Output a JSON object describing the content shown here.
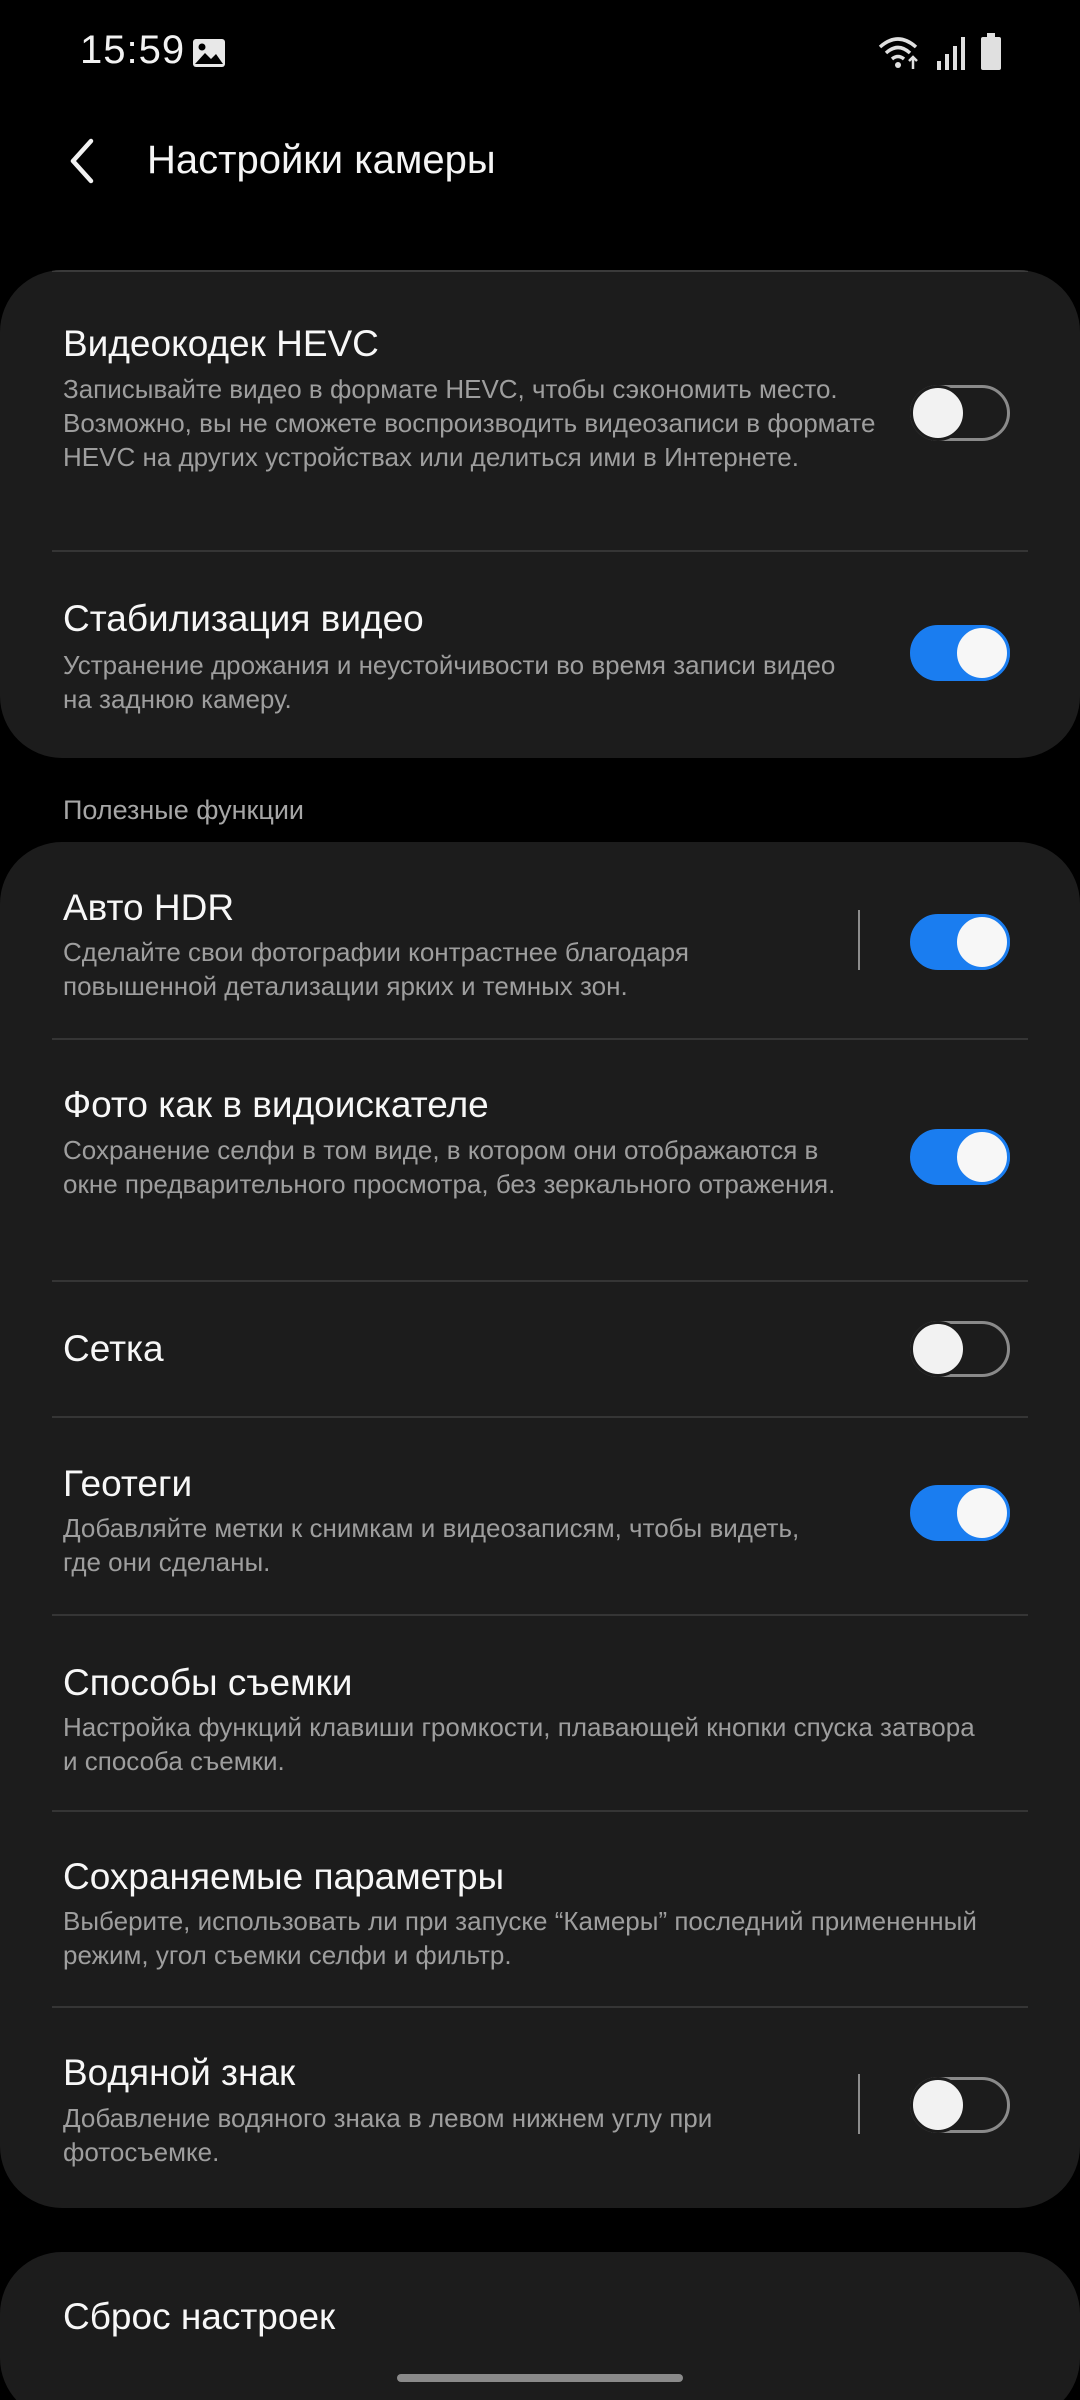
{
  "status_bar": {
    "time": "15:59",
    "icons": [
      "gallery-icon",
      "wifi-icon",
      "signal-icon",
      "battery-icon"
    ]
  },
  "header": {
    "back_icon": "chevron-left-icon",
    "title": "Настройки камеры"
  },
  "video_settings": [
    {
      "title": "Видеокодек HEVC",
      "description": "Записывайте видео в формате HEVC, чтобы сэкономить место. Возможно, вы не сможете воспроизводить видеозаписи в формате HEVC на других устройствах или делиться ими в Интернете.",
      "toggle": "off"
    },
    {
      "title": "Стабилизация видео",
      "description": "Устранение дрожания и неустойчивости во время записи видео на заднюю камеру.",
      "toggle": "on"
    }
  ],
  "useful_section": {
    "header": "Полезные функции",
    "items": [
      {
        "title": "Авто HDR",
        "description": "Сделайте свои фотографии контрастнее благодаря повышенной детализации ярких и темных зон.",
        "toggle": "on"
      },
      {
        "title": "Фото как в видоискателе",
        "description": "Сохранение селфи в том виде, в котором они отображаются в окне предварительного просмотра, без зеркального отражения.",
        "toggle": "on"
      },
      {
        "title": "Сетка",
        "description": "",
        "toggle": "off"
      },
      {
        "title": "Геотеги",
        "description": "Добавляйте метки к снимкам и видеозаписям, чтобы видеть, где они сделаны.",
        "toggle": "on"
      },
      {
        "title": "Способы съемки",
        "description": "Настройка функций клавиши громкости, плавающей кнопки спуска затвора и способа съемки."
      },
      {
        "title": "Сохраняемые параметры",
        "description": "Выберите, использовать ли при запуске “Камеры” последний примененный режим, угол съемки селфи и фильтр."
      },
      {
        "title": "Водяной знак",
        "description": "Добавление водяного знака в левом нижнем углу при фотосъемке.",
        "toggle": "off"
      }
    ]
  },
  "reset": {
    "title": "Сброс настроек"
  },
  "colors": {
    "background": "#000000",
    "card": "#1c1c1c",
    "accent": "#1a7df0",
    "secondary_text": "#9e9e9e"
  }
}
